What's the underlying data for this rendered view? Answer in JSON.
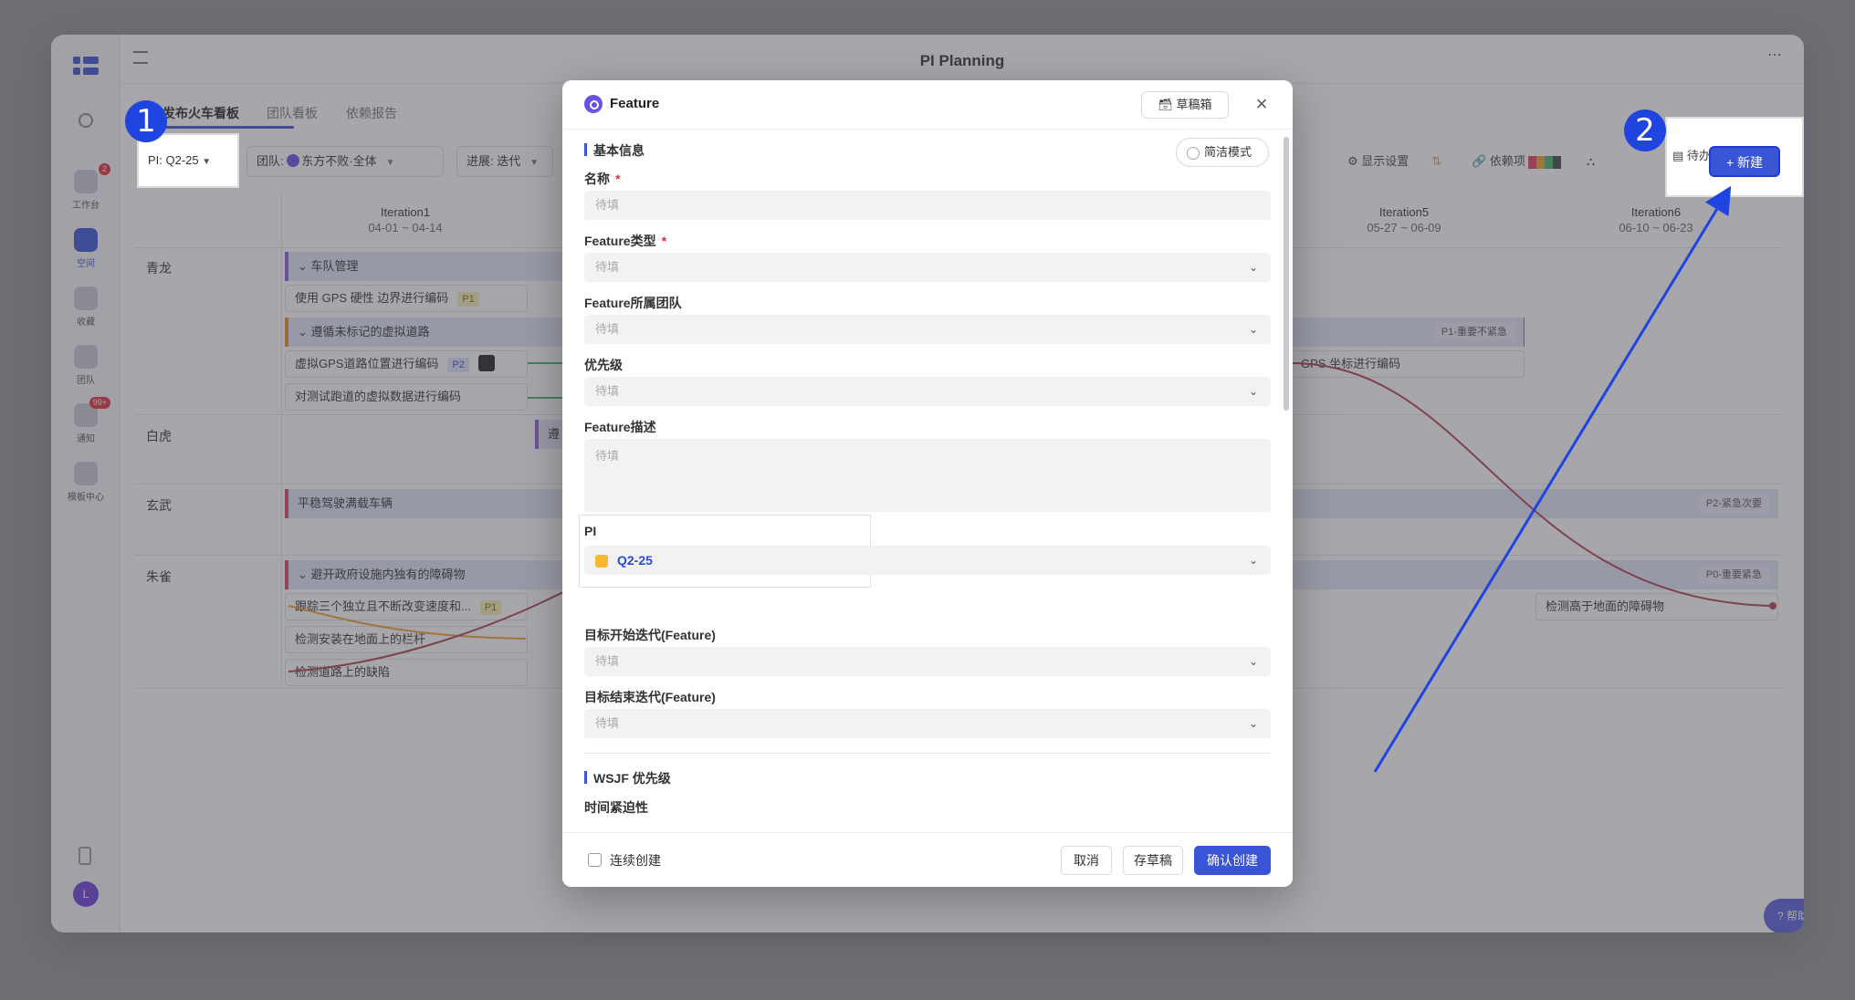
{
  "app": {
    "window_title": "PI Planning",
    "tabs": [
      "发布火车看板",
      "团队看板",
      "依赖报告"
    ],
    "sidebar": [
      {
        "label": "工作台",
        "badge": "2"
      },
      {
        "label": "空间",
        "badge": ""
      },
      {
        "label": "收藏",
        "badge": ""
      },
      {
        "label": "团队",
        "badge": ""
      },
      {
        "label": "通知",
        "badge": "99+"
      },
      {
        "label": "模板中心",
        "badge": ""
      }
    ],
    "avatar_initial": "L",
    "filters": {
      "pi": "PI:  Q2-25",
      "team_prefix": "团队:",
      "team_value": "东方不败·全体",
      "progress_prefix": "进展:",
      "progress_value": "迭代"
    },
    "toolbar": {
      "display_settings": "显示设置",
      "dependencies": "依赖项",
      "todo": "待办项",
      "new": "新建"
    },
    "iterations": [
      {
        "name": "Iteration1",
        "dates": "04-01 ~ 04-14"
      },
      {
        "name": "Iteration5",
        "dates": "05-27 ~ 06-09"
      },
      {
        "name": "Iteration6",
        "dates": "06-10 ~ 06-23"
      }
    ],
    "lanes": [
      "青龙",
      "白虎",
      "玄武",
      "朱雀"
    ],
    "board": {
      "epic_1": "车队管理",
      "card_1": "使用 GPS 硬性 边界进行编码",
      "card_1_tag": "P1",
      "epic_2": "遵循未标记的虚拟道路",
      "epic_2_tag": "P1-重要不紧急",
      "card_2": "虚拟GPS道路位置进行编码",
      "card_2_tag": "P2",
      "card_2_right": "GPS 坐标进行编码",
      "card_3": "对测试跑道的虚拟数据进行编码",
      "baihu_stub": "遵",
      "epic_3": "平稳驾驶满载车辆",
      "epic_3_tag": "P2-紧急次要",
      "epic_4": "避开政府设施内独有的障碍物",
      "epic_4_tag": "P0-重要紧急",
      "card_4": "跟踪三个独立且不断改变速度和...",
      "card_4_tag": "P1",
      "card_5": "检测安装在地面上的栏杆",
      "card_6": "检测道路上的缺陷",
      "card_7": "检测高于地面的障碍物"
    },
    "help": "帮助"
  },
  "annotations": {
    "step1": "1",
    "step2": "2"
  },
  "modal": {
    "title": "Feature",
    "drafts_button": "草稿箱",
    "section_basic": "基本信息",
    "simple_mode": "简洁模式",
    "fields": {
      "name_label": "名称",
      "type_label": "Feature类型",
      "team_label": "Feature所属团队",
      "priority_label": "优先级",
      "desc_label": "Feature描述",
      "pi_label": "PI",
      "pi_value": "Q2-25",
      "start_iter_label": "目标开始迭代(Feature)",
      "end_iter_label": "目标结束迭代(Feature)",
      "placeholder": "待填",
      "required_mark": "*"
    },
    "section_wsjf": "WSJF 优先级",
    "urgency_label": "时间紧迫性",
    "footer": {
      "continuous": "连续创建",
      "cancel": "取消",
      "save_draft": "存草稿",
      "confirm": "确认创建"
    }
  }
}
